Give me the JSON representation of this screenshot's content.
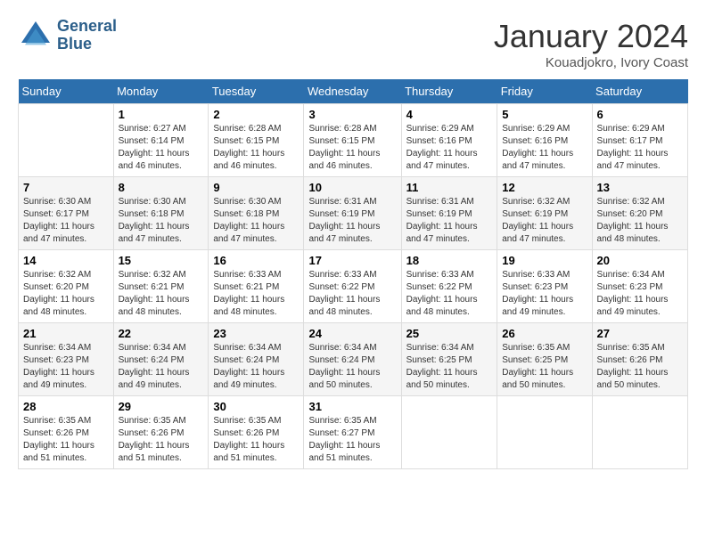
{
  "header": {
    "logo_line1": "General",
    "logo_line2": "Blue",
    "month": "January 2024",
    "location": "Kouadjokro, Ivory Coast"
  },
  "days_of_week": [
    "Sunday",
    "Monday",
    "Tuesday",
    "Wednesday",
    "Thursday",
    "Friday",
    "Saturday"
  ],
  "weeks": [
    [
      {
        "day": "",
        "info": ""
      },
      {
        "day": "1",
        "info": "Sunrise: 6:27 AM\nSunset: 6:14 PM\nDaylight: 11 hours\nand 46 minutes."
      },
      {
        "day": "2",
        "info": "Sunrise: 6:28 AM\nSunset: 6:15 PM\nDaylight: 11 hours\nand 46 minutes."
      },
      {
        "day": "3",
        "info": "Sunrise: 6:28 AM\nSunset: 6:15 PM\nDaylight: 11 hours\nand 46 minutes."
      },
      {
        "day": "4",
        "info": "Sunrise: 6:29 AM\nSunset: 6:16 PM\nDaylight: 11 hours\nand 47 minutes."
      },
      {
        "day": "5",
        "info": "Sunrise: 6:29 AM\nSunset: 6:16 PM\nDaylight: 11 hours\nand 47 minutes."
      },
      {
        "day": "6",
        "info": "Sunrise: 6:29 AM\nSunset: 6:17 PM\nDaylight: 11 hours\nand 47 minutes."
      }
    ],
    [
      {
        "day": "7",
        "info": "Sunrise: 6:30 AM\nSunset: 6:17 PM\nDaylight: 11 hours\nand 47 minutes."
      },
      {
        "day": "8",
        "info": "Sunrise: 6:30 AM\nSunset: 6:18 PM\nDaylight: 11 hours\nand 47 minutes."
      },
      {
        "day": "9",
        "info": "Sunrise: 6:30 AM\nSunset: 6:18 PM\nDaylight: 11 hours\nand 47 minutes."
      },
      {
        "day": "10",
        "info": "Sunrise: 6:31 AM\nSunset: 6:19 PM\nDaylight: 11 hours\nand 47 minutes."
      },
      {
        "day": "11",
        "info": "Sunrise: 6:31 AM\nSunset: 6:19 PM\nDaylight: 11 hours\nand 47 minutes."
      },
      {
        "day": "12",
        "info": "Sunrise: 6:32 AM\nSunset: 6:19 PM\nDaylight: 11 hours\nand 47 minutes."
      },
      {
        "day": "13",
        "info": "Sunrise: 6:32 AM\nSunset: 6:20 PM\nDaylight: 11 hours\nand 48 minutes."
      }
    ],
    [
      {
        "day": "14",
        "info": "Sunrise: 6:32 AM\nSunset: 6:20 PM\nDaylight: 11 hours\nand 48 minutes."
      },
      {
        "day": "15",
        "info": "Sunrise: 6:32 AM\nSunset: 6:21 PM\nDaylight: 11 hours\nand 48 minutes."
      },
      {
        "day": "16",
        "info": "Sunrise: 6:33 AM\nSunset: 6:21 PM\nDaylight: 11 hours\nand 48 minutes."
      },
      {
        "day": "17",
        "info": "Sunrise: 6:33 AM\nSunset: 6:22 PM\nDaylight: 11 hours\nand 48 minutes."
      },
      {
        "day": "18",
        "info": "Sunrise: 6:33 AM\nSunset: 6:22 PM\nDaylight: 11 hours\nand 48 minutes."
      },
      {
        "day": "19",
        "info": "Sunrise: 6:33 AM\nSunset: 6:23 PM\nDaylight: 11 hours\nand 49 minutes."
      },
      {
        "day": "20",
        "info": "Sunrise: 6:34 AM\nSunset: 6:23 PM\nDaylight: 11 hours\nand 49 minutes."
      }
    ],
    [
      {
        "day": "21",
        "info": "Sunrise: 6:34 AM\nSunset: 6:23 PM\nDaylight: 11 hours\nand 49 minutes."
      },
      {
        "day": "22",
        "info": "Sunrise: 6:34 AM\nSunset: 6:24 PM\nDaylight: 11 hours\nand 49 minutes."
      },
      {
        "day": "23",
        "info": "Sunrise: 6:34 AM\nSunset: 6:24 PM\nDaylight: 11 hours\nand 49 minutes."
      },
      {
        "day": "24",
        "info": "Sunrise: 6:34 AM\nSunset: 6:24 PM\nDaylight: 11 hours\nand 50 minutes."
      },
      {
        "day": "25",
        "info": "Sunrise: 6:34 AM\nSunset: 6:25 PM\nDaylight: 11 hours\nand 50 minutes."
      },
      {
        "day": "26",
        "info": "Sunrise: 6:35 AM\nSunset: 6:25 PM\nDaylight: 11 hours\nand 50 minutes."
      },
      {
        "day": "27",
        "info": "Sunrise: 6:35 AM\nSunset: 6:26 PM\nDaylight: 11 hours\nand 50 minutes."
      }
    ],
    [
      {
        "day": "28",
        "info": "Sunrise: 6:35 AM\nSunset: 6:26 PM\nDaylight: 11 hours\nand 51 minutes."
      },
      {
        "day": "29",
        "info": "Sunrise: 6:35 AM\nSunset: 6:26 PM\nDaylight: 11 hours\nand 51 minutes."
      },
      {
        "day": "30",
        "info": "Sunrise: 6:35 AM\nSunset: 6:26 PM\nDaylight: 11 hours\nand 51 minutes."
      },
      {
        "day": "31",
        "info": "Sunrise: 6:35 AM\nSunset: 6:27 PM\nDaylight: 11 hours\nand 51 minutes."
      },
      {
        "day": "",
        "info": ""
      },
      {
        "day": "",
        "info": ""
      },
      {
        "day": "",
        "info": ""
      }
    ]
  ]
}
